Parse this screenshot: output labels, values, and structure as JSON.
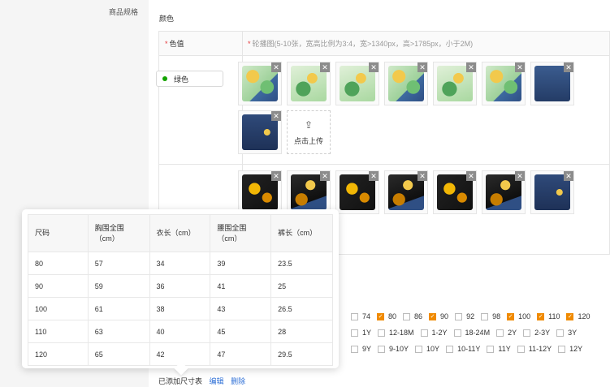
{
  "section": {
    "label": "商品规格"
  },
  "color_section": {
    "title": "颜色"
  },
  "table": {
    "col1_header": "色值",
    "col2_header": "轮播图(5-10张，宽高比例为3:4，宽>1340px，高>1785px，小于2M)"
  },
  "row1": {
    "color_name": "绿色",
    "color_dot": "#13a300",
    "upload_label": "点击上传",
    "thumb_count": 7
  },
  "row2": {
    "thumb_count": 6
  },
  "sizes": {
    "row1": [
      {
        "label": "74",
        "checked": false
      },
      {
        "label": "80",
        "checked": true
      },
      {
        "label": "86",
        "checked": false
      },
      {
        "label": "90",
        "checked": true
      },
      {
        "label": "92",
        "checked": false
      },
      {
        "label": "98",
        "checked": false
      },
      {
        "label": "100",
        "checked": true
      },
      {
        "label": "110",
        "checked": true
      },
      {
        "label": "120",
        "checked": true
      }
    ],
    "row2": [
      {
        "label": "1Y",
        "checked": false
      },
      {
        "label": "12-18M",
        "checked": false
      },
      {
        "label": "1-2Y",
        "checked": false
      },
      {
        "label": "18-24M",
        "checked": false
      },
      {
        "label": "2Y",
        "checked": false
      },
      {
        "label": "2-3Y",
        "checked": false
      },
      {
        "label": "3Y",
        "checked": false
      }
    ],
    "row3": [
      {
        "label": "9Y",
        "checked": false
      },
      {
        "label": "9-10Y",
        "checked": false
      },
      {
        "label": "10Y",
        "checked": false
      },
      {
        "label": "10-11Y",
        "checked": false
      },
      {
        "label": "11Y",
        "checked": false
      },
      {
        "label": "11-12Y",
        "checked": false
      },
      {
        "label": "12Y",
        "checked": false
      }
    ]
  },
  "size_chart_footer": {
    "text": "已添加尺寸表",
    "edit": "编辑",
    "delete": "删除"
  },
  "size_popup": {
    "headers": [
      "尺码",
      "胸围全围\n（cm）",
      "衣长（cm）",
      "腰围全围\n（cm）",
      "裤长（cm）"
    ],
    "rows": [
      [
        "80",
        "57",
        "34",
        "39",
        "23.5"
      ],
      [
        "90",
        "59",
        "36",
        "41",
        "25"
      ],
      [
        "100",
        "61",
        "38",
        "43",
        "26.5"
      ],
      [
        "110",
        "63",
        "40",
        "45",
        "28"
      ],
      [
        "120",
        "65",
        "42",
        "47",
        "29.5"
      ]
    ]
  },
  "colors": {
    "accent_orange": "#f08a00",
    "link_blue": "#2d6fd6",
    "required_red": "#e4393c"
  }
}
